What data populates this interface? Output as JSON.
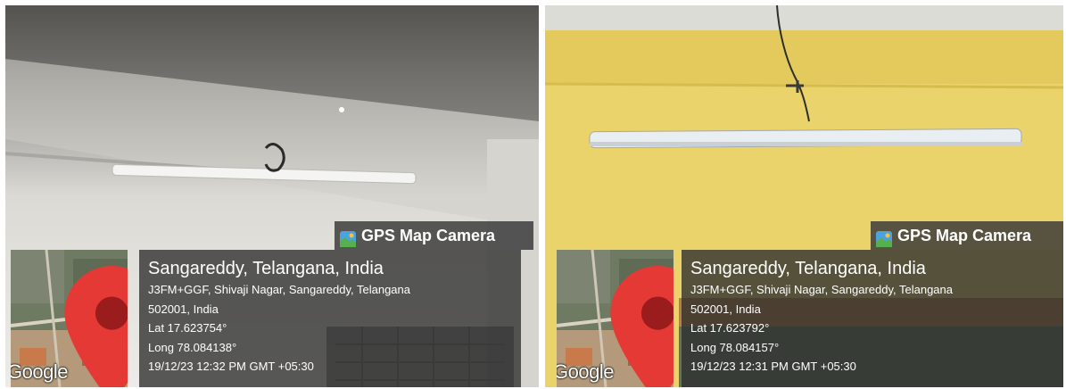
{
  "photos": [
    {
      "brand": {
        "label": "GPS Map Camera",
        "icon": "gps-map-camera-icon"
      },
      "map": {
        "attribution": "Google",
        "icon": "location-pin-icon"
      },
      "location": {
        "title": "Sangareddy, Telangana, India",
        "address_line1": "J3FM+GGF, Shivaji Nagar, Sangareddy, Telangana",
        "address_line2": "502001, India",
        "lat": "Lat 17.623754°",
        "long": "Long 78.084138°",
        "datetime": "19/12/23 12:32 PM GMT +05:30"
      }
    },
    {
      "brand": {
        "label": "GPS Map Camera",
        "icon": "gps-map-camera-icon"
      },
      "map": {
        "attribution": "Google",
        "icon": "location-pin-icon"
      },
      "location": {
        "title": "Sangareddy, Telangana, India",
        "address_line1": "J3FM+GGF, Shivaji Nagar, Sangareddy, Telangana",
        "address_line2": "502001, India",
        "lat": "Lat 17.623792°",
        "long": "Long 78.084157°",
        "datetime": "19/12/23 12:31 PM GMT +05:30"
      }
    }
  ],
  "colors": {
    "overlay": "#373737",
    "pin": "#e53935",
    "wall_left": "#e8e6e1",
    "wall_right": "#e9d36a"
  }
}
